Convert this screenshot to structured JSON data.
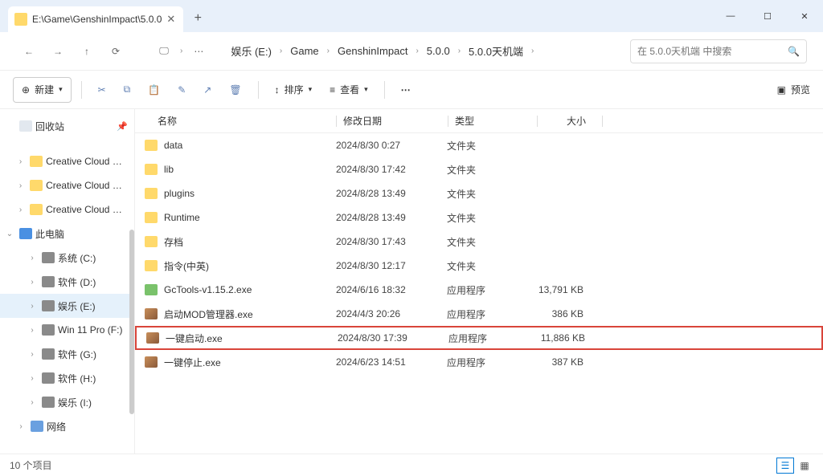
{
  "tab": {
    "title": "E:\\Game\\GenshinImpact\\5.0.0"
  },
  "breadcrumb": {
    "items": [
      "娱乐 (E:)",
      "Game",
      "GenshinImpact",
      "5.0.0",
      "5.0.0天机端"
    ]
  },
  "search": {
    "placeholder": "在 5.0.0天机端 中搜索"
  },
  "toolbar": {
    "new_label": "新建",
    "sort_label": "排序",
    "view_label": "查看",
    "preview_label": "预览"
  },
  "sidebar": {
    "recycle": "回收站",
    "items": [
      {
        "label": "Creative Cloud Files",
        "icon": "folder",
        "indent": 1,
        "chev": "›"
      },
      {
        "label": "Creative Cloud Files",
        "icon": "folder",
        "indent": 1,
        "chev": "›"
      },
      {
        "label": "Creative Cloud Files",
        "icon": "folder",
        "indent": 1,
        "chev": "›"
      },
      {
        "label": "此电脑",
        "icon": "pc",
        "indent": 0,
        "chev": "⌄"
      },
      {
        "label": "系统 (C:)",
        "icon": "drive",
        "indent": 2,
        "chev": "›"
      },
      {
        "label": "软件 (D:)",
        "icon": "drive",
        "indent": 2,
        "chev": "›"
      },
      {
        "label": "娱乐 (E:)",
        "icon": "drive",
        "indent": 2,
        "chev": "›",
        "selected": true
      },
      {
        "label": "Win 11 Pro (F:)",
        "icon": "drive",
        "indent": 2,
        "chev": "›"
      },
      {
        "label": "软件 (G:)",
        "icon": "drive",
        "indent": 2,
        "chev": "›"
      },
      {
        "label": "软件 (H:)",
        "icon": "drive",
        "indent": 2,
        "chev": "›"
      },
      {
        "label": "娱乐 (I:)",
        "icon": "drive",
        "indent": 2,
        "chev": "›"
      },
      {
        "label": "网络",
        "icon": "net",
        "indent": 1,
        "chev": "›"
      }
    ]
  },
  "columns": {
    "name": "名称",
    "date": "修改日期",
    "type": "类型",
    "size": "大小"
  },
  "files": [
    {
      "name": "data",
      "date": "2024/8/30 0:27",
      "type": "文件夹",
      "size": "",
      "icon": "folder"
    },
    {
      "name": "lib",
      "date": "2024/8/30 17:42",
      "type": "文件夹",
      "size": "",
      "icon": "folder"
    },
    {
      "name": "plugins",
      "date": "2024/8/28 13:49",
      "type": "文件夹",
      "size": "",
      "icon": "folder"
    },
    {
      "name": "Runtime",
      "date": "2024/8/28 13:49",
      "type": "文件夹",
      "size": "",
      "icon": "folder"
    },
    {
      "name": "存档",
      "date": "2024/8/30 17:43",
      "type": "文件夹",
      "size": "",
      "icon": "folder"
    },
    {
      "name": "指令(中英)",
      "date": "2024/8/30 12:17",
      "type": "文件夹",
      "size": "",
      "icon": "folder"
    },
    {
      "name": "GcTools-v1.15.2.exe",
      "date": "2024/6/16 18:32",
      "type": "应用程序",
      "size": "13,791 KB",
      "icon": "exe2"
    },
    {
      "name": "启动MOD管理器.exe",
      "date": "2024/4/3 20:26",
      "type": "应用程序",
      "size": "386 KB",
      "icon": "exe"
    },
    {
      "name": "一键启动.exe",
      "date": "2024/8/30 17:39",
      "type": "应用程序",
      "size": "11,886 KB",
      "icon": "exe",
      "highlight": true
    },
    {
      "name": "一键停止.exe",
      "date": "2024/6/23 14:51",
      "type": "应用程序",
      "size": "387 KB",
      "icon": "exe"
    }
  ],
  "status": {
    "count": "10 个项目"
  }
}
